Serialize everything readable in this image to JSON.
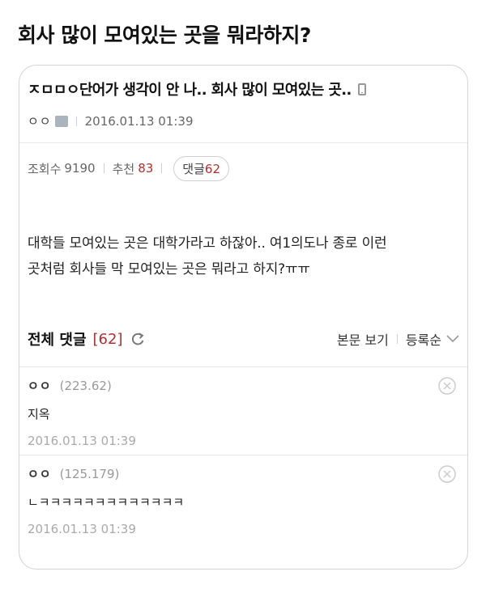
{
  "headline": "회사 많이 모여있는 곳을 뭐라하지?",
  "post": {
    "title": "ㅈㅁㅁㅇ단어가 생각이 안 나.. 회사 많이 모여있는 곳..",
    "author": "ㅇㅇ",
    "date": "2016.01.13 01:39",
    "views_label": "조회수",
    "views": "9190",
    "recommend_label": "추천",
    "recommend": "83",
    "comments_label": "댓글",
    "comments_count": "62",
    "body_line1": "대학들 모여있는 곳은 대학가라고 하잖아.. 여1의도나 종로 이런",
    "body_line2": "곳처럼 회사들 막 모여있는 곳은 뭐라고 하지?ㅠㅠ"
  },
  "comments_header": {
    "title": "전체 댓글",
    "count": "[62]",
    "view_post": "본문 보기",
    "sort": "등록순"
  },
  "comments": [
    {
      "author": "ㅇㅇ",
      "ip": "(223.62)",
      "text": "지옥",
      "date": "2016.01.13 01:39"
    },
    {
      "author": "ㅇㅇ",
      "ip": "(125.179)",
      "text": "ㄴㅋㅋㅋㅋㅋㅋㅋㅋㅋㅋㅋㅋㅋ",
      "date": "2016.01.13 01:39"
    }
  ],
  "icons": [
    "mobile-icon",
    "level-icon",
    "refresh-icon",
    "chevron-down-icon",
    "close-icon"
  ],
  "colors": {
    "accent": "#b03030",
    "border": "#d4d4d4",
    "muted": "#999999"
  }
}
